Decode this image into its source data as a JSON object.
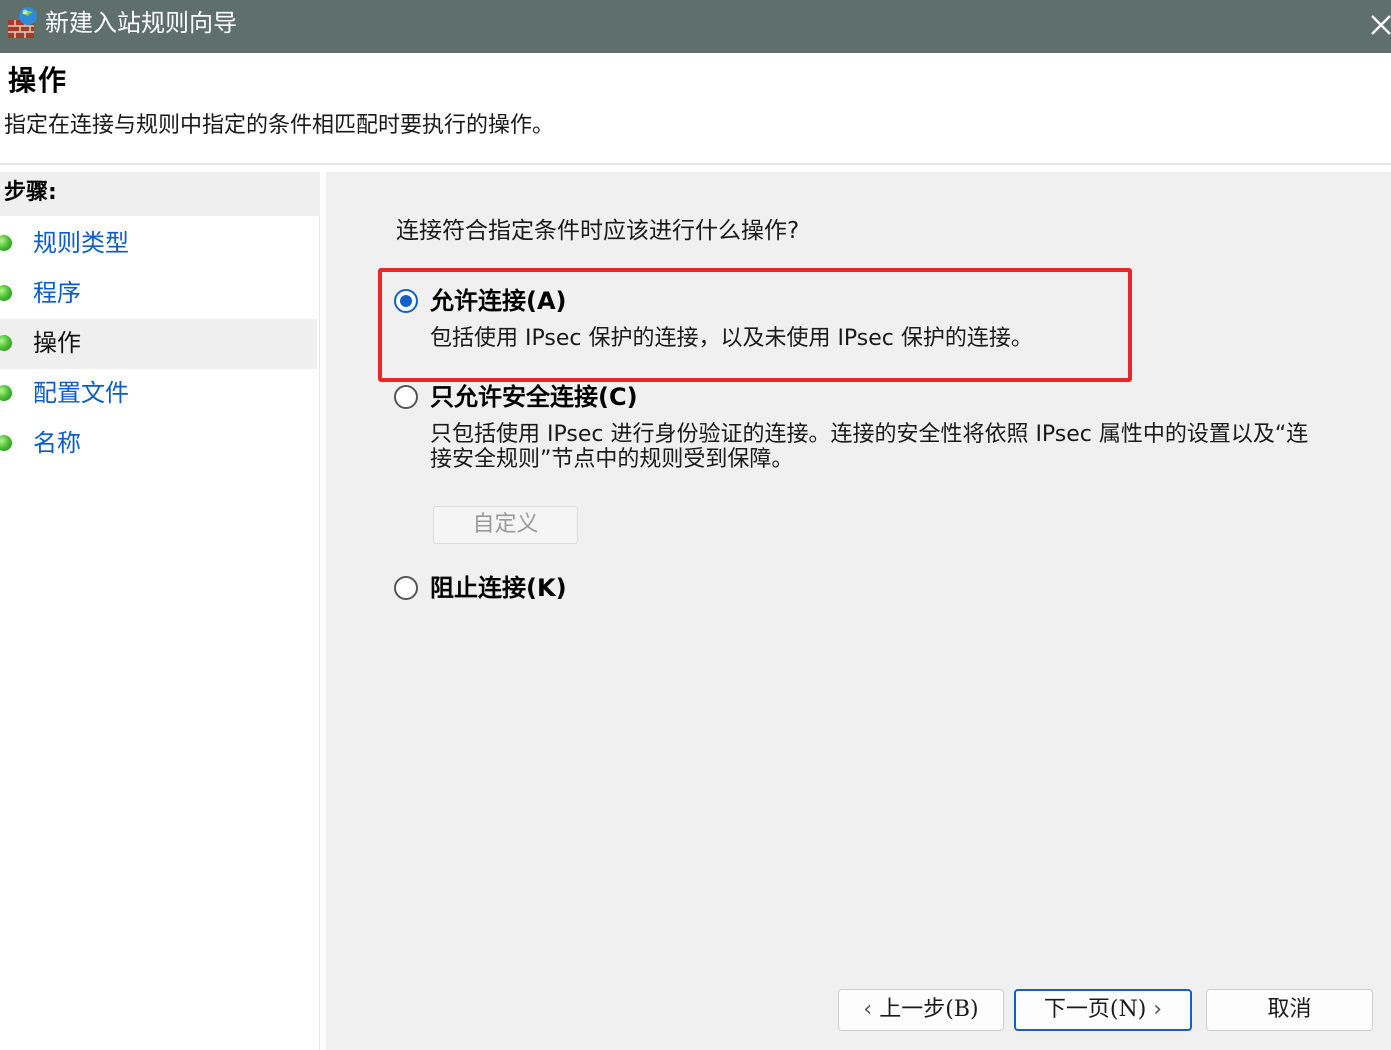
{
  "window": {
    "title": "新建入站规则向导",
    "icon": "firewall-icon",
    "close_icon": "close-icon"
  },
  "header": {
    "title": "操作",
    "description": "指定在连接与规则中指定的条件相匹配时要执行的操作。"
  },
  "sidebar": {
    "title": "步骤:",
    "items": [
      {
        "label": "规则类型",
        "active": false
      },
      {
        "label": "程序",
        "active": false
      },
      {
        "label": "操作",
        "active": true
      },
      {
        "label": "配置文件",
        "active": false
      },
      {
        "label": "名称",
        "active": false
      }
    ]
  },
  "main": {
    "question": "连接符合指定条件时应该进行什么操作?",
    "options": [
      {
        "label": "允许连接(A)",
        "description": "包括使用 IPsec 保护的连接，以及未使用 IPsec 保护的连接。",
        "checked": true
      },
      {
        "label": "只允许安全连接(C)",
        "description": "只包括使用 IPsec 进行身份验证的连接。连接的安全性将依照 IPsec 属性中的设置以及“连接安全规则”节点中的规则受到保障。",
        "checked": false
      },
      {
        "label": "阻止连接(K)",
        "description": "",
        "checked": false
      }
    ],
    "custom_button": "自定义"
  },
  "footer": {
    "back_label": "上一步(B)",
    "next_label": "下一页(N)",
    "cancel_label": "取消"
  },
  "colors": {
    "titlebar": "#5f6f6b",
    "accent": "#1160c8",
    "link": "#0b5cc7",
    "highlight": "#e9272b"
  }
}
